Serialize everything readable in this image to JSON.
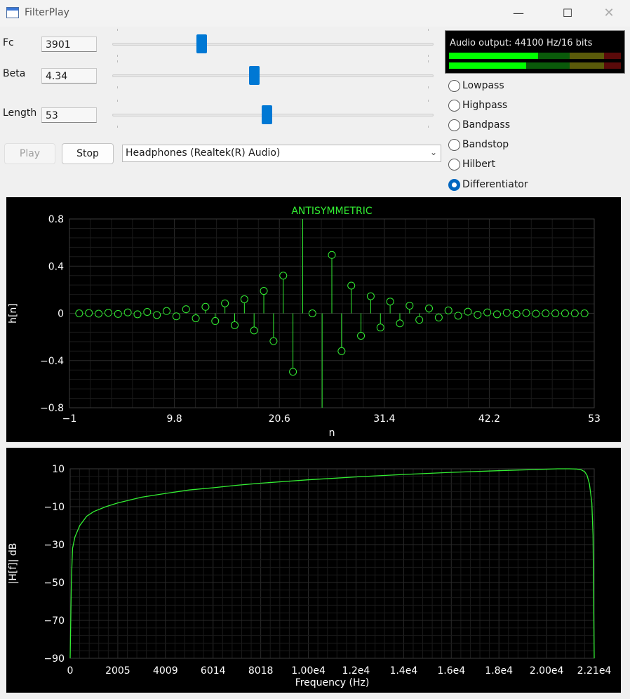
{
  "window": {
    "title": "FilterPlay"
  },
  "params": [
    {
      "label": "Fc",
      "value": "3901",
      "slider_fraction": 0.27
    },
    {
      "label": "Beta",
      "value": "4.34",
      "slider_fraction": 0.44
    },
    {
      "label": "Length",
      "value": "53",
      "slider_fraction": 0.48
    }
  ],
  "controls": {
    "play_label": "Play",
    "stop_label": "Stop",
    "device": "Headphones (Realtek(R) Audio)"
  },
  "meter": {
    "text": "Audio output: 44100 Hz/16 bits",
    "levels": [
      0.52,
      0.45
    ],
    "colors": {
      "active": "#00ff00",
      "dim": "#0a5a0a",
      "warn_dim": "#5a5a0a",
      "peak_dim": "#5a0a0a"
    }
  },
  "filter_types": [
    {
      "label": "Lowpass",
      "selected": false
    },
    {
      "label": "Highpass",
      "selected": false
    },
    {
      "label": "Bandpass",
      "selected": false
    },
    {
      "label": "Bandstop",
      "selected": false
    },
    {
      "label": "Hilbert",
      "selected": false
    },
    {
      "label": "Differentiator",
      "selected": true
    }
  ],
  "colors": {
    "trace": "#33ee33",
    "grid": "#2a2a2a",
    "axis_text": "#ffffff",
    "accent": "#0078d4"
  },
  "chart_data": [
    {
      "type": "scatter",
      "title": "ANTISYMMETRIC",
      "xlabel": "n",
      "ylabel": "h[n]",
      "xlim": [
        -1,
        53
      ],
      "ylim": [
        -0.8,
        0.8
      ],
      "xticks": [
        "−1",
        "9.8",
        "20.6",
        "31.4",
        "42.2",
        "53"
      ],
      "yticks": [
        "0.8",
        "0.4",
        "0",
        "−0.4",
        "−0.8"
      ],
      "x": [
        0,
        1,
        2,
        3,
        4,
        5,
        6,
        7,
        8,
        9,
        10,
        11,
        12,
        13,
        14,
        15,
        16,
        17,
        18,
        19,
        20,
        21,
        22,
        23,
        24,
        25,
        26,
        27,
        28,
        29,
        30,
        31,
        32,
        33,
        34,
        35,
        36,
        37,
        38,
        39,
        40,
        41,
        42,
        43,
        44,
        45,
        46,
        47,
        48,
        49,
        50,
        51,
        52
      ],
      "values": [
        0,
        0.003,
        -0.003,
        0.005,
        -0.005,
        0.008,
        -0.008,
        0.012,
        -0.014,
        0.02,
        -0.025,
        0.035,
        -0.042,
        0.055,
        -0.065,
        0.085,
        -0.1,
        0.12,
        -0.145,
        0.19,
        -0.235,
        0.32,
        -0.495,
        0.9,
        0,
        -0.9,
        0.495,
        -0.32,
        0.235,
        -0.19,
        0.145,
        -0.12,
        0.1,
        -0.085,
        0.065,
        -0.055,
        0.042,
        -0.035,
        0.025,
        -0.02,
        0.014,
        -0.012,
        0.008,
        -0.008,
        0.005,
        -0.005,
        0.003,
        -0.003,
        0,
        0,
        0,
        0,
        0
      ],
      "markers": [
        true,
        true,
        true,
        true,
        true,
        true,
        true,
        true,
        true,
        true,
        true,
        true,
        true,
        true,
        true,
        true,
        true,
        true,
        true,
        true,
        true,
        true,
        true,
        false,
        true,
        false,
        true,
        true,
        true,
        true,
        true,
        true,
        true,
        true,
        true,
        true,
        true,
        true,
        true,
        true,
        true,
        true,
        true,
        true,
        true,
        true,
        true,
        true,
        true,
        true,
        true,
        true,
        true
      ]
    },
    {
      "type": "line",
      "xlabel": "Frequency (Hz)",
      "ylabel": "|H[f]| dB",
      "xlim": [
        0,
        22050
      ],
      "ylim": [
        -90,
        10
      ],
      "xticks": [
        "0",
        "2005",
        "4009",
        "6014",
        "8018",
        "1.00e4",
        "1.2e4",
        "1.4e4",
        "1.6e4",
        "1.8e4",
        "2.00e4",
        "2.21e4"
      ],
      "yticks": [
        "10",
        "−10",
        "−30",
        "−50",
        "−70",
        "−90"
      ],
      "x": [
        0,
        50,
        100,
        200,
        400,
        700,
        1000,
        1500,
        2005,
        3000,
        4009,
        5000,
        6014,
        7000,
        8018,
        9000,
        10000,
        12000,
        14000,
        16000,
        18000,
        19500,
        20500,
        21000,
        21300,
        21500,
        21650,
        21750,
        21850,
        21950,
        22000,
        22050
      ],
      "values": [
        -90,
        -50,
        -32,
        -26,
        -20,
        -15,
        -12.5,
        -10,
        -8,
        -5,
        -3,
        -1.2,
        0,
        1.3,
        2.4,
        3.3,
        4.2,
        5.7,
        7,
        8.1,
        9,
        9.6,
        10,
        10,
        9.9,
        9.5,
        8.5,
        6.5,
        2,
        -8,
        -25,
        -90
      ]
    }
  ]
}
